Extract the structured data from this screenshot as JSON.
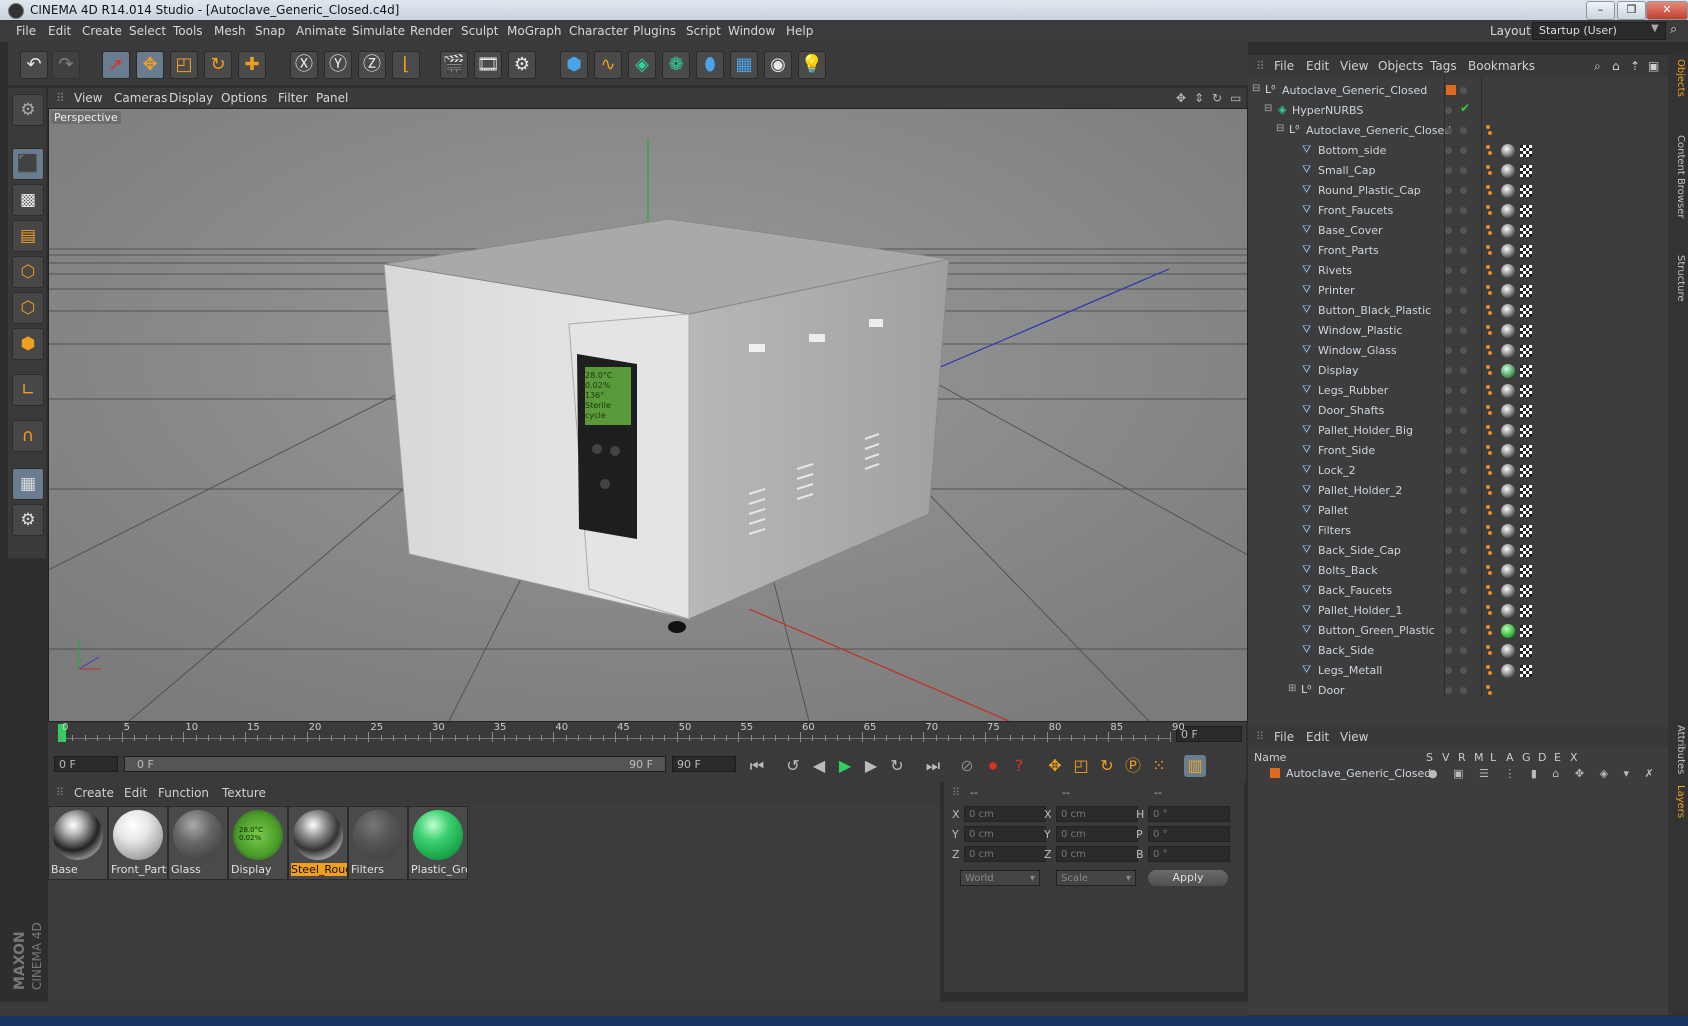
{
  "window": {
    "title": "CINEMA 4D R14.014 Studio - [Autoclave_Generic_Closed.c4d]",
    "buttons": [
      "–",
      "❐",
      "✕"
    ]
  },
  "menubar": {
    "items": [
      "File",
      "Edit",
      "Create",
      "Select",
      "Tools",
      "Mesh",
      "Snap",
      "Animate",
      "Simulate",
      "Render",
      "Sculpt",
      "MoGraph",
      "Character",
      "Plugins",
      "Script",
      "Window",
      "Help"
    ],
    "layout_label": "Layout:",
    "layout_value": "Startup (User)"
  },
  "viewport": {
    "menu": [
      "View",
      "Cameras",
      "Display",
      "Options",
      "Filter",
      "Panel"
    ],
    "label": "Perspective",
    "screen_text": "28.0°C 0.02% 136° Sterile cycle"
  },
  "objects_panel": {
    "menu": [
      "File",
      "Edit",
      "View",
      "Objects",
      "Tags",
      "Bookmarks"
    ],
    "root": "Autoclave_Generic_Closed",
    "hypernurbs": "HyperNURBS",
    "group": "Autoclave_Generic_Closed",
    "children": [
      "Bottom_side",
      "Small_Cap",
      "Round_Plastic_Cap",
      "Front_Faucets",
      "Base_Cover",
      "Front_Parts",
      "Rivets",
      "Printer",
      "Button_Black_Plastic",
      "Window_Plastic",
      "Window_Glass",
      "Display",
      "Legs_Rubber",
      "Door_Shafts",
      "Pallet_Holder_Big",
      "Front_Side",
      "Lock_2",
      "Pallet_Holder_2",
      "Pallet",
      "Filters",
      "Back_Side_Cap",
      "Bolts_Back",
      "Back_Faucets",
      "Pallet_Holder_1",
      "Button_Green_Plastic",
      "Back_Side",
      "Legs_Metall"
    ],
    "door": "Door"
  },
  "side_tabs": [
    "Objects",
    "Content Browser",
    "Structure",
    "Attributes",
    "Layers"
  ],
  "timeline": {
    "ticks": [
      "0",
      "5",
      "10",
      "15",
      "20",
      "25",
      "30",
      "35",
      "40",
      "45",
      "50",
      "55",
      "60",
      "65",
      "70",
      "75",
      "80",
      "85",
      "90"
    ],
    "current_frame": "0 F",
    "start_field": "0 F",
    "range_start": "0 F",
    "range_end": "90 F",
    "end_field": "90 F"
  },
  "materials": {
    "menu": [
      "Create",
      "Edit",
      "Function",
      "Texture"
    ],
    "items": [
      {
        "name": "Base",
        "style": "chrome"
      },
      {
        "name": "Front_Parts",
        "style": "white"
      },
      {
        "name": "Glass",
        "style": "glass"
      },
      {
        "name": "Display",
        "style": "display"
      },
      {
        "name": "Steel_Roug",
        "style": "steel"
      },
      {
        "name": "Filters",
        "style": "filters"
      },
      {
        "name": "Plastic_Gre",
        "style": "green"
      }
    ],
    "selected": "Steel_Roug",
    "display_swatch_text": "28.0°C 0.02%"
  },
  "coordinates": {
    "headers": [
      "--",
      "--",
      "--"
    ],
    "rows": [
      {
        "a": "X",
        "av": "0 cm",
        "b": "X",
        "bv": "0 cm",
        "c": "H",
        "cv": "0 °"
      },
      {
        "a": "Y",
        "av": "0 cm",
        "b": "Y",
        "bv": "0 cm",
        "c": "P",
        "cv": "0 °"
      },
      {
        "a": "Z",
        "av": "0 cm",
        "b": "Z",
        "bv": "0 cm",
        "c": "B",
        "cv": "0 °"
      }
    ],
    "world": "World",
    "scale": "Scale",
    "apply": "Apply"
  },
  "layers_panel": {
    "menu": [
      "File",
      "Edit",
      "View"
    ],
    "col_name": "Name",
    "cols": [
      "S",
      "V",
      "R",
      "M",
      "L",
      "A",
      "G",
      "D",
      "E",
      "X"
    ],
    "row": "Autoclave_Generic_Closed"
  },
  "brand": {
    "maxon": "MAXON",
    "c4d": "CINEMA 4D"
  },
  "colors": {
    "accent": "#f0a020",
    "selection": "#f0a020",
    "axis_x": "#c03020",
    "axis_y": "#20c030",
    "axis_z": "#3040c0"
  }
}
